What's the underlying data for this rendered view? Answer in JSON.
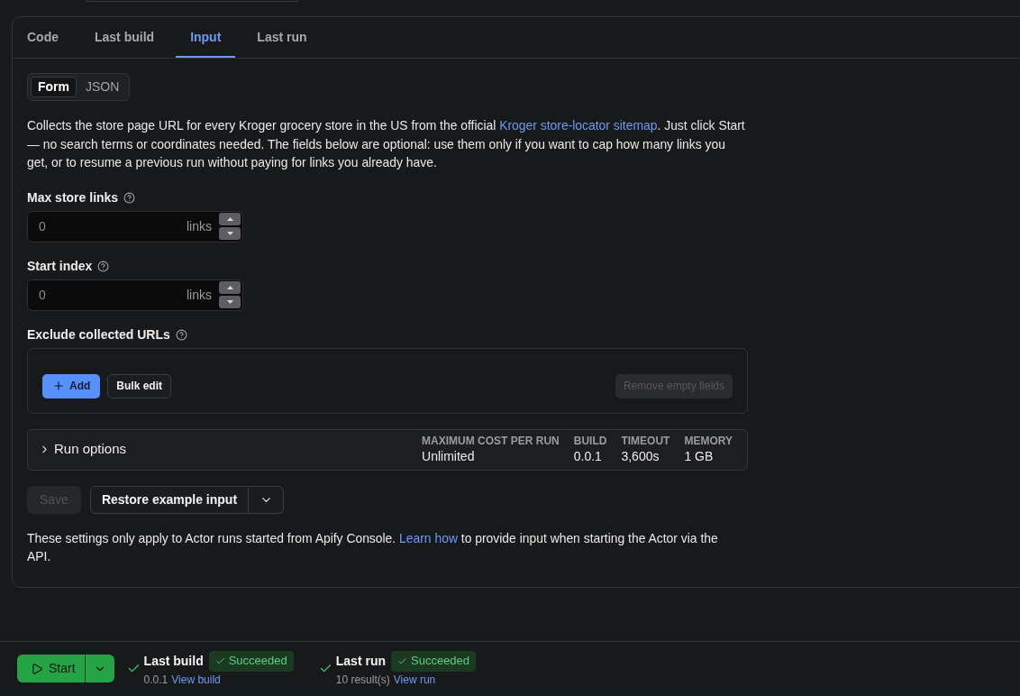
{
  "tabs": [
    {
      "label": "Code",
      "selected": false
    },
    {
      "label": "Last build",
      "selected": false
    },
    {
      "label": "Input",
      "selected": true
    },
    {
      "label": "Last run",
      "selected": false
    }
  ],
  "input_mode": [
    {
      "label": "Form",
      "selected": true
    },
    {
      "label": "JSON",
      "selected": false
    }
  ],
  "description": {
    "text_before": "Collects the store page URL for every Kroger grocery store in the US from the official ",
    "link": "Kroger store-locator sitemap",
    "text_after": ". Just click Start — no search terms or coordinates needed. The fields below are optional: use them only if you want to cap how many links you get, or to resume a previous run without paying for links you already have."
  },
  "fields": [
    {
      "kind": "number",
      "label": "Max store links",
      "placeholder": "0",
      "unit": "links"
    },
    {
      "kind": "number",
      "label": "Start index",
      "placeholder": "0",
      "unit": "links"
    },
    {
      "kind": "url_list",
      "label": "Exclude collected URLs",
      "buttons": [
        {
          "kind": "add",
          "label": "Add"
        },
        {
          "kind": "plain",
          "label": "Bulk edit"
        }
      ],
      "remove_button": {
        "label": "Remove empty fields",
        "disabled": true
      }
    }
  ],
  "run_options": {
    "label": "Run options",
    "expanded": false,
    "stats": [
      {
        "label": "MAXIMUM COST PER RUN",
        "value": "Unlimited"
      },
      {
        "label": "BUILD",
        "value": "0.0.1"
      },
      {
        "label": "TIMEOUT",
        "value": "3,600s"
      },
      {
        "label": "MEMORY",
        "value": "1 GB"
      }
    ]
  },
  "save_button": {
    "label": "Save",
    "disabled": true
  },
  "restore_button": {
    "label": "Restore example input"
  },
  "note": {
    "text_before": "These settings only apply to Actor runs started from Apify Console. ",
    "link": "Learn how",
    "text_after": " to provide input when starting the Actor via the API."
  },
  "start_button": {
    "label": "Start"
  },
  "statuses": [
    {
      "title": "Last build",
      "kind": "success",
      "status": "Succeeded",
      "detail": "0.0.1",
      "link": "View build"
    },
    {
      "title": "Last run",
      "kind": "success",
      "status": "Succeeded",
      "detail": "10 result(s)",
      "link": "View run"
    }
  ]
}
